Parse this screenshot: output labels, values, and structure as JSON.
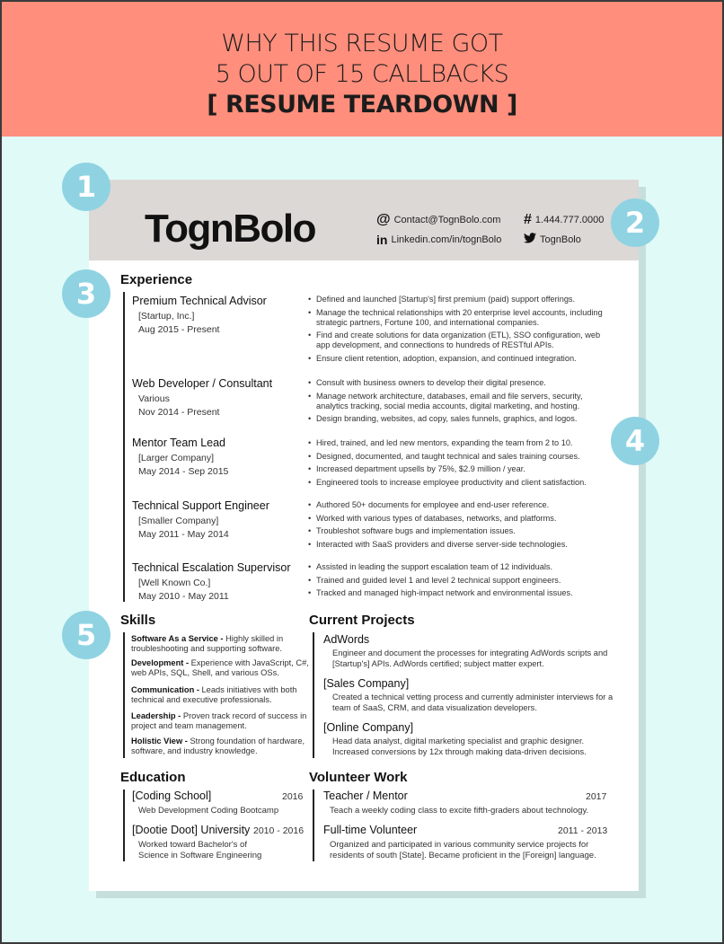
{
  "banner": {
    "line1": "WHY THIS RESUME GOT",
    "line2": "5 OUT OF 15 CALLBACKS",
    "line3": "[ RESUME TEARDOWN ]"
  },
  "colors": {
    "banner": "#FF8E7C",
    "background": "#E0FAF7",
    "badge": "#8FD3E2",
    "resume_header": "#DCD8D6"
  },
  "badges": [
    "1",
    "2",
    "3",
    "4",
    "5"
  ],
  "resume": {
    "name": "TognBolo",
    "contact": {
      "email_icon": "@",
      "email": "Contact@TognBolo.com",
      "phone_icon": "#",
      "phone": "1.444.777.0000",
      "linkedin_icon": "in",
      "linkedin": "Linkedin.com/in/tognBolo",
      "twitter_icon": "🐦",
      "twitter": "TognBolo"
    },
    "experience": {
      "title": "Experience",
      "jobs": [
        {
          "title": "Premium Technical Advisor",
          "company": "[Startup, Inc.]",
          "dates": "Aug 2015 - Present",
          "bullets": [
            "Defined and launched [Startup's] first premium (paid) support offerings.",
            "Manage the technical relationships with 20 enterprise level accounts, including strategic partners, Fortune 100, and international companies.",
            "Find and create solutions for data organization (ETL), SSO configuration, web app development, and connections to hundreds of RESTful APIs.",
            "Ensure client retention, adoption, expansion, and continued integration."
          ]
        },
        {
          "title": "Web Developer / Consultant",
          "company": "Various",
          "dates": "Nov 2014 - Present",
          "bullets": [
            "Consult with business owners to develop their digital presence.",
            "Manage network architecture, databases, email and file servers, security, analytics tracking, social media accounts, digital marketing, and hosting.",
            "Design branding, websites, ad copy, sales funnels, graphics, and logos."
          ]
        },
        {
          "title": "Mentor Team Lead",
          "company": "[Larger Company]",
          "dates": "May 2014 - Sep 2015",
          "bullets": [
            "Hired, trained, and led new mentors, expanding the team from 2 to 10.",
            "Designed, documented, and taught technical and sales training courses.",
            "Increased department upsells by 75%, $2.9 million / year.",
            "Engineered tools to increase employee productivity and client satisfaction."
          ]
        },
        {
          "title": "Technical Support Engineer",
          "company": "[Smaller Company]",
          "dates": "May 2011 - May 2014",
          "bullets": [
            "Authored 50+ documents for employee and end-user reference.",
            "Worked with various types of databases, networks, and platforms.",
            "Troubleshot software bugs and implementation issues.",
            "Interacted with SaaS providers and diverse server-side technologies."
          ]
        },
        {
          "title": "Technical Escalation Supervisor",
          "company": "[Well Known Co.]",
          "dates": "May 2010 - May 2011",
          "bullets": [
            "Assisted in leading the support escalation team of 12 individuals.",
            "Trained and guided level 1 and level 2 technical support engineers.",
            "Tracked and managed high-impact network and environmental issues."
          ]
        }
      ]
    },
    "skills": {
      "title": "Skills",
      "items": [
        {
          "name": "Software As a Service - ",
          "desc": "Highly skilled in troubleshooting and supporting software."
        },
        {
          "name": "Development - ",
          "desc": "Experience with JavaScript, C#, web APIs, SQL, Shell, and various OSs."
        },
        {
          "name": "Communication - ",
          "desc": "Leads initiatives with both technical and executive professionals."
        },
        {
          "name": "Leadership - ",
          "desc": "Proven track record of success in project and team management."
        },
        {
          "name": "Holistic View - ",
          "desc": "Strong foundation of hardware, software, and industry knowledge."
        }
      ]
    },
    "projects": {
      "title": "Current Projects",
      "items": [
        {
          "name": "AdWords",
          "desc": "Engineer and document the processes for integrating AdWords scripts and [Startup's] APIs. AdWords certified; subject matter expert."
        },
        {
          "name": "[Sales Company]",
          "desc": "Created a technical vetting process and currently administer interviews for a team of SaaS, CRM, and data visualization developers."
        },
        {
          "name": "[Online Company]",
          "desc": "Head data analyst, digital marketing specialist and graphic designer. Increased conversions by 12x through making data-driven decisions."
        }
      ]
    },
    "education": {
      "title": "Education",
      "items": [
        {
          "name": "[Coding School]",
          "year": "2016",
          "desc": "Web Development Coding Bootcamp"
        },
        {
          "name": "[Dootie Doot] University",
          "year": "2010 - 2016",
          "desc": "Worked toward Bachelor's of Science in Software Engineering"
        }
      ]
    },
    "volunteer": {
      "title": "Volunteer Work",
      "items": [
        {
          "name": "Teacher / Mentor",
          "year": "2017",
          "desc": "Teach a weekly coding class to excite fifth-graders about technology."
        },
        {
          "name": "Full-time Volunteer",
          "year": "2011 - 2013",
          "desc": "Organized and participated in various community service projects for residents of south [State]. Became proficient in the [Foreign] language."
        }
      ]
    }
  }
}
